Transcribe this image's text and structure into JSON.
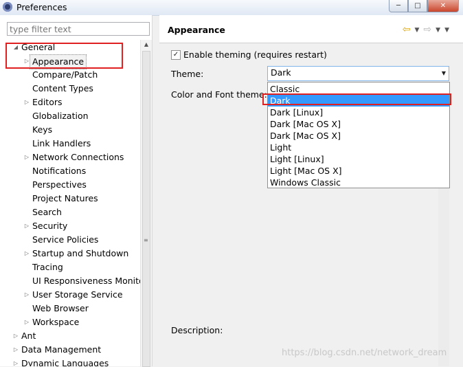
{
  "window": {
    "title": "Preferences"
  },
  "filter": {
    "placeholder": "type filter text"
  },
  "tree": [
    {
      "label": "General",
      "level": 0,
      "toggle": "expanded"
    },
    {
      "label": "Appearance",
      "level": 1,
      "toggle": "collapsed",
      "selected": true
    },
    {
      "label": "Compare/Patch",
      "level": 1,
      "toggle": "none"
    },
    {
      "label": "Content Types",
      "level": 1,
      "toggle": "none"
    },
    {
      "label": "Editors",
      "level": 1,
      "toggle": "collapsed"
    },
    {
      "label": "Globalization",
      "level": 1,
      "toggle": "none"
    },
    {
      "label": "Keys",
      "level": 1,
      "toggle": "none"
    },
    {
      "label": "Link Handlers",
      "level": 1,
      "toggle": "none"
    },
    {
      "label": "Network Connections",
      "level": 1,
      "toggle": "collapsed"
    },
    {
      "label": "Notifications",
      "level": 1,
      "toggle": "none"
    },
    {
      "label": "Perspectives",
      "level": 1,
      "toggle": "none"
    },
    {
      "label": "Project Natures",
      "level": 1,
      "toggle": "none"
    },
    {
      "label": "Search",
      "level": 1,
      "toggle": "none"
    },
    {
      "label": "Security",
      "level": 1,
      "toggle": "collapsed"
    },
    {
      "label": "Service Policies",
      "level": 1,
      "toggle": "none"
    },
    {
      "label": "Startup and Shutdown",
      "level": 1,
      "toggle": "collapsed"
    },
    {
      "label": "Tracing",
      "level": 1,
      "toggle": "none"
    },
    {
      "label": "UI Responsiveness Monito",
      "level": 1,
      "toggle": "none"
    },
    {
      "label": "User Storage Service",
      "level": 1,
      "toggle": "collapsed"
    },
    {
      "label": "Web Browser",
      "level": 1,
      "toggle": "none"
    },
    {
      "label": "Workspace",
      "level": 1,
      "toggle": "collapsed"
    },
    {
      "label": "Ant",
      "level": 0,
      "toggle": "collapsed"
    },
    {
      "label": "Data Management",
      "level": 0,
      "toggle": "collapsed"
    },
    {
      "label": "Dynamic Languages",
      "level": 0,
      "toggle": "collapsed"
    }
  ],
  "page": {
    "title": "Appearance",
    "enable_theming": {
      "label": "Enable theming (requires restart)",
      "checked": true
    },
    "theme_label": "Theme:",
    "theme_value": "Dark",
    "color_font_label": "Color and Font theme:",
    "theme_options": [
      "Classic",
      "Dark",
      "Dark [Linux]",
      "Dark [Mac OS X]",
      "Dark [Mac OS X]",
      "Light",
      "Light [Linux]",
      "Light [Mac OS X]",
      "Windows Classic"
    ],
    "highlighted_option": "Dark",
    "description_label": "Description:"
  },
  "watermark": "https://blog.csdn.net/network_dream",
  "colors": {
    "highlight": "#3399ff",
    "annotation": "#e02020"
  }
}
